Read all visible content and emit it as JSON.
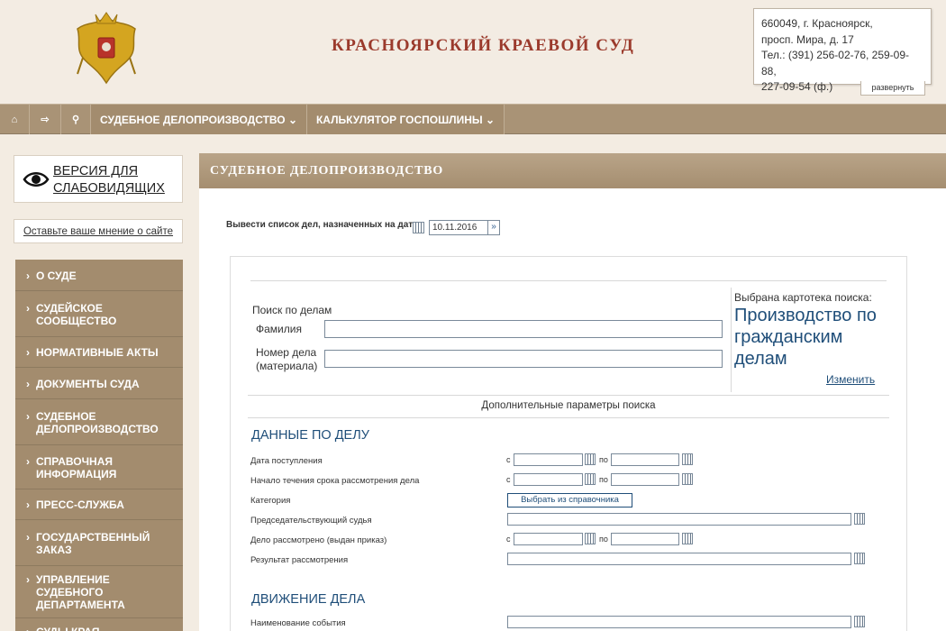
{
  "header": {
    "title": "КРАСНОЯРСКИЙ КРАЕВОЙ СУД",
    "contact_lines": [
      "660049, г. Красноярск,",
      "просп. Мира, д. 17",
      "Тел.: (391) 256-02-76, 259-09-88,",
      "227-09-54 (ф.)"
    ],
    "expand_label": "развернуть"
  },
  "nav": {
    "home_icon": "⌂",
    "login_icon": "⇨",
    "search_icon": "⚲",
    "items": [
      {
        "label": "СУДЕБНОЕ ДЕЛОПРОИЗВОДСТВО ⌄"
      },
      {
        "label": "КАЛЬКУЛЯТОР ГОСПОШЛИНЫ ⌄"
      }
    ]
  },
  "sidebar": {
    "vision_label_1": "ВЕРСИЯ ДЛЯ",
    "vision_label_2": "СЛАБОВИДЯЩИХ",
    "opinion_label": "Оставьте ваше мнение о сайте",
    "arrow": "›",
    "menu": [
      {
        "lines": [
          "О СУДЕ"
        ]
      },
      {
        "lines": [
          "СУДЕЙСКОЕ",
          "СООБЩЕСТВО"
        ]
      },
      {
        "lines": [
          "НОРМАТИВНЫЕ АКТЫ"
        ]
      },
      {
        "lines": [
          "ДОКУМЕНТЫ СУДА"
        ]
      },
      {
        "lines": [
          "СУДЕБНОЕ",
          "ДЕЛОПРОИЗВОДСТВО"
        ]
      },
      {
        "lines": [
          "СПРАВОЧНАЯ",
          "ИНФОРМАЦИЯ"
        ]
      },
      {
        "lines": [
          "ПРЕСС-СЛУЖБА"
        ]
      },
      {
        "lines": [
          "ГОСУДАРСТВЕННЫЙ",
          "ЗАКАЗ"
        ]
      },
      {
        "lines": [
          "УПРАВЛЕНИЕ",
          "СУДЕБНОГО",
          "ДЕПАРТАМЕНТА"
        ]
      },
      {
        "lines": [
          "СУДЫ КРАЯ"
        ]
      }
    ]
  },
  "main": {
    "heading": "СУДЕБНОЕ ДЕЛОПРОИЗВОДСТВО",
    "date_prompt": "Вывести список дел, назначенных на дату",
    "date_value": "10.11.2016",
    "go_symbol": "»",
    "search_title": "Поиск по делам",
    "surname_label": "Фамилия",
    "case_number_label_1": "Номер дела",
    "case_number_label_2": "(материала)",
    "selected_label": "Выбрана картотека поиска:",
    "selected_value": "Производство по гражданским делам",
    "change_link": "Изменить",
    "extra_params": "Дополнительные параметры поиска",
    "section_case_data": "ДАННЫЕ ПО ДЕЛУ",
    "section_case_movement": "ДВИЖЕНИЕ ДЕЛА",
    "from_label": "с",
    "to_label": "по",
    "rows": {
      "receipt_date": "Дата поступления",
      "review_start": "Начало течения срока рассмотрения дела",
      "category": "Категория",
      "judge": "Председательствующий судья",
      "considered": "Дело рассмотрено (выдан приказ)",
      "result": "Результат рассмотрения",
      "event_name": "Наименование события"
    },
    "dict_button": "Выбрать из справочника"
  }
}
